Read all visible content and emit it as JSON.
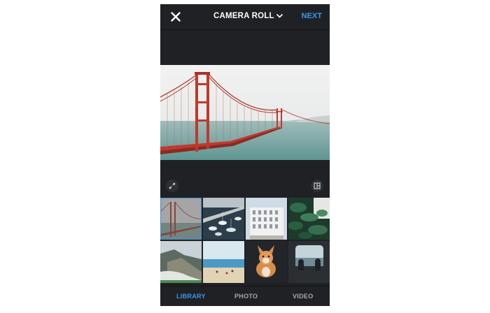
{
  "header": {
    "title": "CAMERA ROLL",
    "next_label": "NEXT",
    "close_icon": "close-icon",
    "dropdown_icon": "chevron-down-icon"
  },
  "preview": {
    "image": "golden-gate-bridge-photo"
  },
  "tools": {
    "expand_icon": "expand-icon",
    "layout_icon": "layout-icon"
  },
  "gallery": {
    "items": [
      {
        "name": "golden-gate-bridge",
        "selected": true
      },
      {
        "name": "marina-boats",
        "selected": false
      },
      {
        "name": "white-building",
        "selected": false
      },
      {
        "name": "plants",
        "selected": false
      },
      {
        "name": "coastline",
        "selected": false
      },
      {
        "name": "beach",
        "selected": false
      },
      {
        "name": "corgi-dog",
        "selected": false
      },
      {
        "name": "window-people",
        "selected": false
      }
    ]
  },
  "tabs": [
    {
      "label": "LIBRARY",
      "active": true
    },
    {
      "label": "PHOTO",
      "active": false
    },
    {
      "label": "VIDEO",
      "active": false
    }
  ],
  "colors": {
    "accent": "#3897f0",
    "background": "#1f2125",
    "inactive_tab": "#a7a9ac"
  }
}
